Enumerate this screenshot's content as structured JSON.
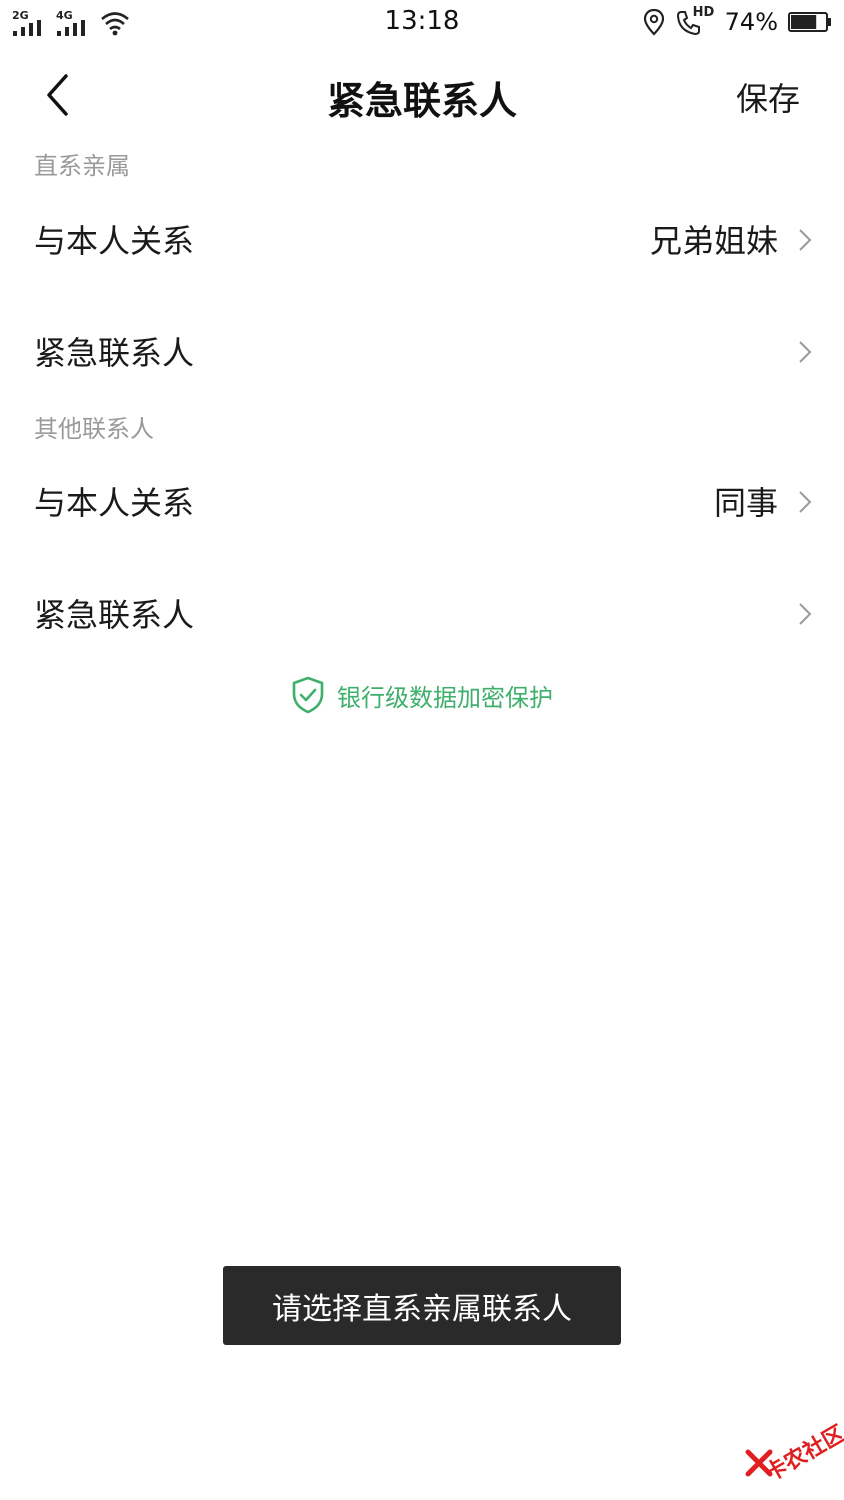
{
  "status_bar": {
    "network_1": "2G",
    "network_2": "4G",
    "time": "13:18",
    "hd_label": "HD",
    "battery_percent": "74%",
    "battery_level": 0.74,
    "icons": [
      "signal-icon",
      "wifi-icon",
      "location-icon",
      "hd-call-icon",
      "battery-icon"
    ]
  },
  "nav": {
    "back_icon": "chevron-left-icon",
    "title": "紧急联系人",
    "save_label": "保存"
  },
  "sections": [
    {
      "header": "直系亲属",
      "rows": [
        {
          "label": "与本人关系",
          "value": "兄弟姐妹"
        },
        {
          "label": "紧急联系人",
          "value": ""
        }
      ]
    },
    {
      "header": "其他联系人",
      "rows": [
        {
          "label": "与本人关系",
          "value": "同事"
        },
        {
          "label": "紧急联系人",
          "value": ""
        }
      ]
    }
  ],
  "security_note": {
    "icon": "shield-check-icon",
    "text": "银行级数据加密保护",
    "color": "#3fb06c"
  },
  "toast": {
    "text": "请选择直系亲属联系人"
  },
  "watermark": {
    "text": "卡农社区"
  }
}
